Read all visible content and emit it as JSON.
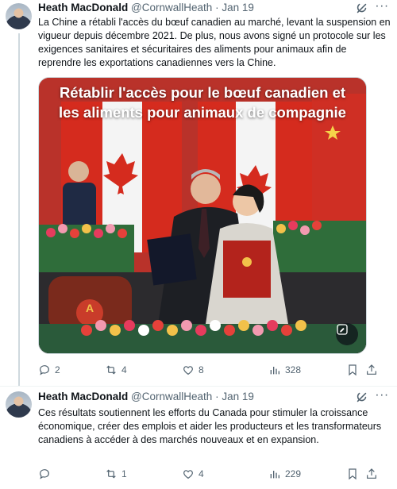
{
  "tweets": [
    {
      "author_name": "Heath MacDonald",
      "handle": "@CornwallHeath",
      "separator": "·",
      "time": "Jan 19",
      "text": "La Chine a rétabli l'accès du bœuf canadien au marché, levant la suspension en vigueur depuis décembre 2021. De plus, nous avons signé un protocole sur les exigences sanitaires et sécuritaires des aliments pour animaux afin de reprendre les exportations canadiennes vers la Chine.",
      "media": {
        "title_line1": "Rétablir l'accès pour le bœuf canadien et",
        "title_line2": "les aliments pour animaux de compagnie",
        "placard_letter": "A"
      },
      "replies": "2",
      "reposts": "4",
      "likes": "8",
      "views": "328"
    },
    {
      "author_name": "Heath MacDonald",
      "handle": "@CornwallHeath",
      "separator": "·",
      "time": "Jan 19",
      "text": "Ces résultats soutiennent les efforts du Canada pour stimuler la croissance économique, créer des emplois et aider les producteurs et les transformateurs canadiens à accéder à des marchés nouveaux et en expansion.",
      "replies": "",
      "reposts": "1",
      "likes": "4",
      "views": "229"
    }
  ],
  "icons": {
    "more": "more-icon",
    "grok": "grok-icon",
    "reply": "reply-icon",
    "repost": "repost-icon",
    "like": "heart-icon",
    "views": "views-icon",
    "bookmark": "bookmark-icon",
    "share": "share-icon"
  },
  "colors": {
    "text": "#0f1419",
    "secondary": "#536471",
    "flag_red": "#d52b1e",
    "border": "#cfd9de"
  }
}
